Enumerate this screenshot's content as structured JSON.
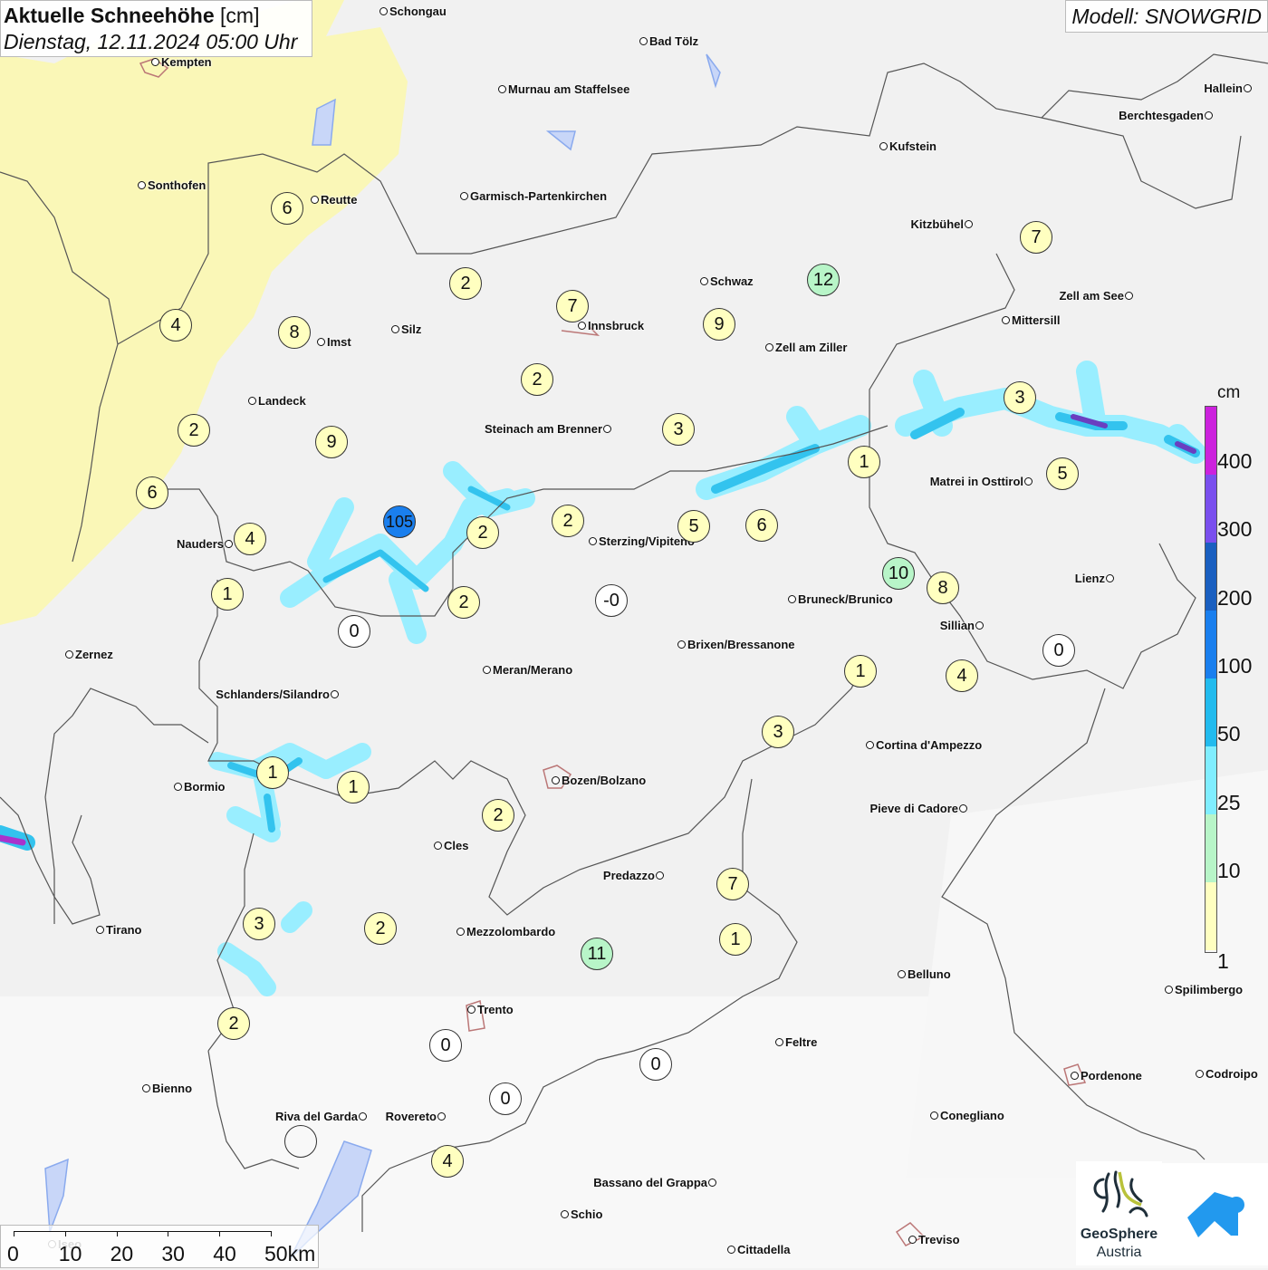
{
  "header": {
    "title": "Aktuelle Schneehöhe",
    "unit": "[cm]",
    "datetime": "Dienstag, 12.11.2024 05:00 Uhr",
    "model": "Modell: SNOWGRID"
  },
  "legend": {
    "unit": "cm",
    "labels": [
      "400",
      "300",
      "200",
      "100",
      "50",
      "25",
      "10",
      "1"
    ],
    "colors": [
      "#cc22dd",
      "#7a4fee",
      "#1a5fc0",
      "#1a7fee",
      "#22bbee",
      "#80eeff",
      "#b8f5c8",
      "#ffffc0"
    ]
  },
  "cities": [
    "Schongau",
    "Bad Tölz",
    "Kempten",
    "Murnau am Staffelsee",
    "Hallein",
    "Berchtesgaden",
    "Kufstein",
    "Sonthofen",
    "Reutte",
    "Garmisch-Partenkirchen",
    "Kitzbühel",
    "Zell am See",
    "Schwaz",
    "Innsbruck",
    "Mittersill",
    "Silz",
    "Imst",
    "Zell am Ziller",
    "Landeck",
    "Steinach am Brenner",
    "Matrei in Osttirol",
    "Nauders",
    "Sterzing/Vipiteno",
    "Lienz",
    "Bruneck/Brunico",
    "Sillian",
    "Brixen/Bressanone",
    "Zernez",
    "Meran/Merano",
    "Schlanders/Silandro",
    "Cortina d'Ampezzo",
    "Bozen/Bolzano",
    "Bormio",
    "Pieve di Cadore",
    "Cles",
    "Predazzo",
    "Tirano",
    "Mezzolombardo",
    "Belluno",
    "Spilimbergo",
    "Trento",
    "Feltre",
    "Pordenone",
    "Codroipo",
    "Bienno",
    "Riva del Garda",
    "Rovereto",
    "Conegliano",
    "Bassano del Grappa",
    "Schio",
    "Treviso",
    "Cittadella",
    "Iseo"
  ],
  "snow_values": [
    "6",
    "4",
    "8",
    "2",
    "7",
    "12",
    "7",
    "9",
    "2",
    "2",
    "9",
    "3",
    "3",
    "1",
    "5",
    "6",
    "105",
    "2",
    "2",
    "5",
    "6",
    "4",
    "1",
    "2",
    "-0",
    "0",
    "10",
    "8",
    "0",
    "1",
    "4",
    "3",
    "1",
    "1",
    "2",
    "7",
    "3",
    "2",
    "11",
    "1",
    "2",
    "0",
    "0",
    "0",
    "4",
    ""
  ],
  "scale": {
    "ticks": [
      "0",
      "10",
      "20",
      "30",
      "40",
      "50km"
    ]
  },
  "logos": {
    "geosphere_line1": "GeoSphere",
    "geosphere_line2": "Austria"
  }
}
